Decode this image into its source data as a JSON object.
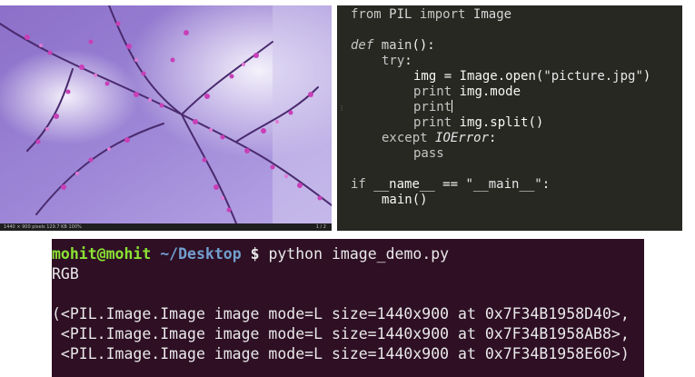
{
  "viewer": {
    "status_left": "1440 × 900 pixels  129.7 KB  100%",
    "status_right": "1 / 2"
  },
  "editor": {
    "line1": {
      "kw_from": "from",
      "module": "PIL",
      "kw_import": "import",
      "name": "Image"
    },
    "line3": {
      "kw_def": "def",
      "fn": "main",
      "rest": "():"
    },
    "line4": {
      "kw": "try",
      "rest": ":"
    },
    "line5": {
      "var": "img",
      "eq": " = ",
      "call": "Image.open(",
      "str": "\"picture.jpg\"",
      "close": ")"
    },
    "line6": {
      "kw": "print",
      "rest": " img.mode"
    },
    "line7": {
      "kw": "print"
    },
    "line8": {
      "kw": "print",
      "rest": " img.split()"
    },
    "line9": {
      "kw": "except",
      "exc": "IOError",
      "rest": ":"
    },
    "line10": {
      "kw": "pass"
    },
    "line12": {
      "kw": "if",
      "name": "__name__",
      "op": " == ",
      "str": "\"__main__\"",
      "rest": ":"
    },
    "line13": {
      "call": "main()"
    }
  },
  "terminal": {
    "prompt_user": "mohit@mohit",
    "prompt_path": "~/Desktop",
    "prompt_symbol": "$",
    "command": "python image_demo.py",
    "lines": [
      "RGB",
      "",
      "(<PIL.Image.Image image mode=L size=1440x900 at 0x7F34B1958D40>,",
      " <PIL.Image.Image image mode=L size=1440x900 at 0x7F34B1958AB8>,",
      " <PIL.Image.Image image mode=L size=1440x900 at 0x7F34B1958E60>)"
    ]
  },
  "colors": {
    "editor_bg": "#272822",
    "terminal_bg": "#2e0f24",
    "prompt_user": "#8ae234",
    "prompt_path": "#729fcf"
  }
}
